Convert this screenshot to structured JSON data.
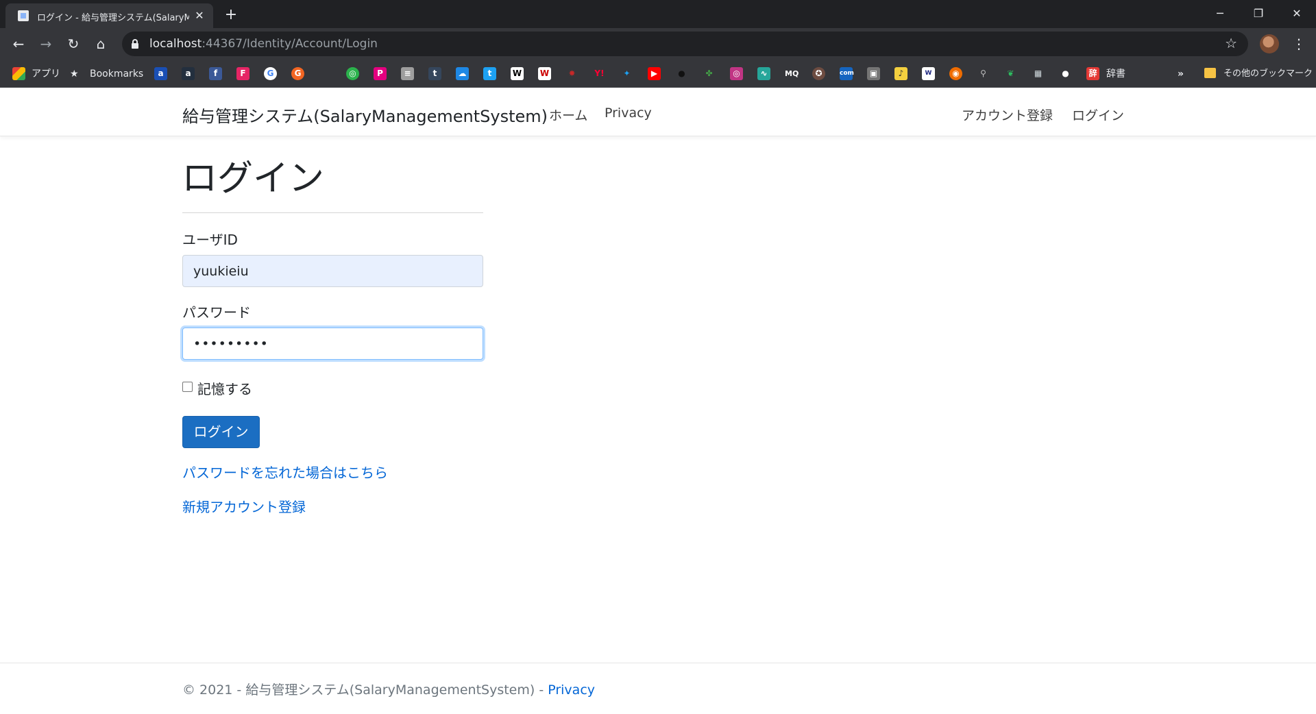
{
  "browser": {
    "tab_title": "ログイン - 給与管理システム(SalaryM",
    "url_host": "localhost",
    "url_path": ":44367/Identity/Account/Login",
    "bookmarks": {
      "apps_label": "アプリ",
      "bookmarks_label": "Bookmarks",
      "dictionary_label": "辞書",
      "overflow_label": "»",
      "other_label": "その他のブックマーク"
    }
  },
  "navbar": {
    "brand": "給与管理システム(SalaryManagementSystem)",
    "home": "ホーム",
    "privacy": "Privacy",
    "register": "アカウント登録",
    "login": "ログイン"
  },
  "form": {
    "heading": "ログイン",
    "userid_label": "ユーザID",
    "userid_value": "yuukieiu",
    "password_label": "パスワード",
    "password_value": "•••••••••",
    "remember_label": "記憶する",
    "submit_label": "ログイン",
    "forgot_link": "パスワードを忘れた場合はこちら",
    "register_link": "新規アカウント登録"
  },
  "footer": {
    "copyright": "© 2021 - 給与管理システム(SalaryManagementSystem) - ",
    "privacy_link": "Privacy"
  },
  "colors": {
    "link": "#0366d6",
    "primary_button": "#1b6ec2",
    "autofill_bg": "#e8f0fe"
  }
}
